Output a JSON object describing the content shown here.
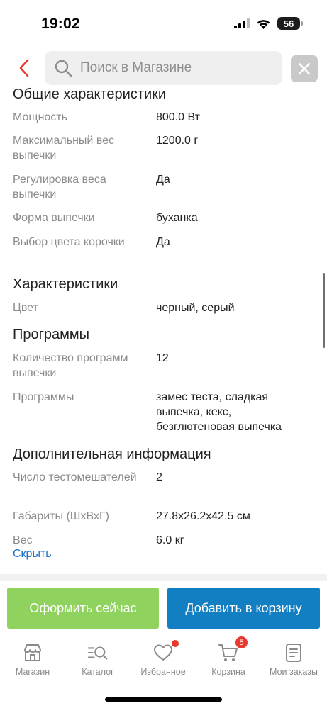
{
  "status": {
    "time": "19:02",
    "battery": "56"
  },
  "search": {
    "placeholder": "Поиск в Магазине"
  },
  "sections": [
    {
      "title": "Общие характеристики",
      "rows": [
        {
          "label": "Мощность",
          "value": "800.0 Вт"
        },
        {
          "label": "Максимальный вес выпечки",
          "value": "1200.0 г"
        },
        {
          "label": "Регулировка веса выпечки",
          "value": "Да"
        },
        {
          "label": "Форма выпечки",
          "value": "буханка"
        },
        {
          "label": "Выбор цвета корочки",
          "value": "Да"
        }
      ]
    },
    {
      "title": "Характеристики",
      "rows": [
        {
          "label": "Цвет",
          "value": "черный, серый"
        }
      ]
    },
    {
      "title": "Программы",
      "rows": [
        {
          "label": "Количество программ выпечки",
          "value": "12"
        },
        {
          "label": "Программы",
          "value": "замес теста, сладкая выпечка, кекс, безглютеновая выпечка"
        }
      ]
    },
    {
      "title": "Дополнительная информация",
      "rows": [
        {
          "label": "Число тестомешателей",
          "value": "2"
        },
        {
          "label": "Габариты (ШхВхГ)",
          "value": "27.8x26.2x42.5 см"
        },
        {
          "label": "Вес",
          "value": "6.0 кг"
        }
      ]
    }
  ],
  "hide_link": "Скрыть",
  "actions": {
    "order_now": "Оформить сейчас",
    "add_to_cart": "Добавить в корзину"
  },
  "tabs": [
    {
      "label": "Магазин",
      "icon": "store-icon"
    },
    {
      "label": "Каталог",
      "icon": "catalog-search-icon"
    },
    {
      "label": "Избранное",
      "icon": "heart-icon"
    },
    {
      "label": "Корзина",
      "icon": "cart-icon",
      "badge": "5"
    },
    {
      "label": "Мои заказы",
      "icon": "orders-icon"
    }
  ],
  "colors": {
    "accent_red": "#e8392f",
    "link_blue": "#1a73c9",
    "order_green": "#8fd25e",
    "cart_blue": "#127fc3"
  }
}
